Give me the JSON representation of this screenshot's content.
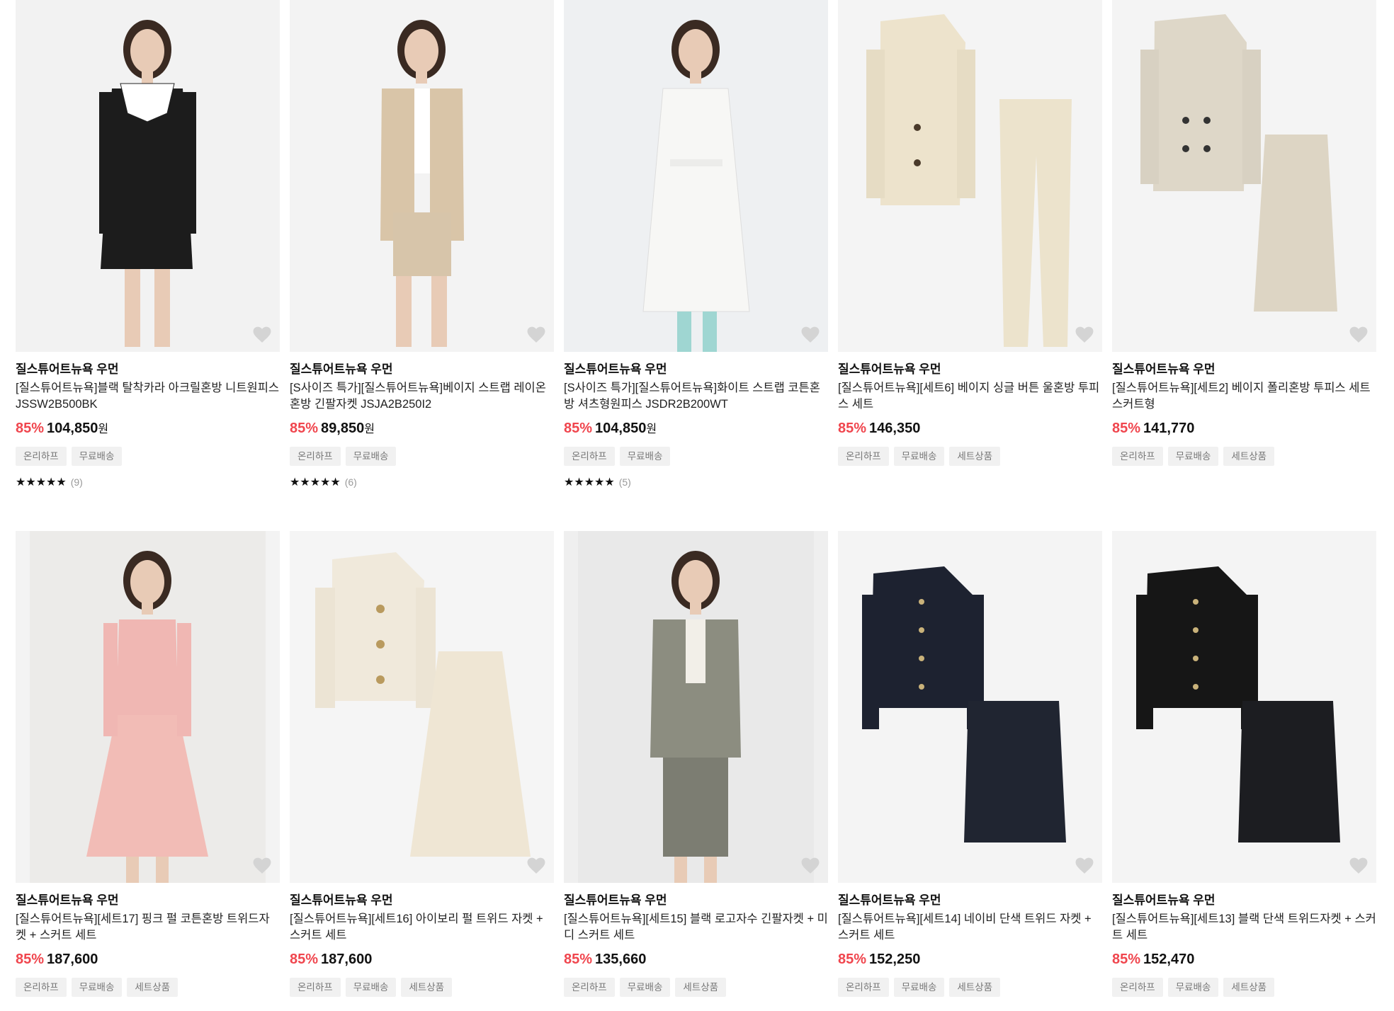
{
  "products": [
    {
      "brand": "질스튜어트뉴욕 우먼",
      "name": "[질스튜어트뉴욕]블랙 탈착카라 아크릴혼방 니트원피스 JSSW2B500BK",
      "discount": "85%",
      "price": "104,850",
      "currency": "원",
      "tags": [
        "온리하프",
        "무료배송"
      ],
      "stars": "★★★★★",
      "review_count": "(9)",
      "image": "model-black-knit-dress"
    },
    {
      "brand": "질스튜어트뉴욕 우먼",
      "name": "[S사이즈 특가][질스튜어트뉴욕]베이지 스트랩 레이온혼방 긴팔자켓 JSJA2B250I2",
      "discount": "85%",
      "price": "89,850",
      "currency": "원",
      "tags": [
        "온리하프",
        "무료배송"
      ],
      "stars": "★★★★★",
      "review_count": "(6)",
      "image": "model-beige-strap-jacket"
    },
    {
      "brand": "질스튜어트뉴욕 우먼",
      "name": "[S사이즈 특가][질스튜어트뉴욕]화이트 스트랩 코튼혼방 셔츠형원피스 JSDR2B200WT",
      "discount": "85%",
      "price": "104,850",
      "currency": "원",
      "tags": [
        "온리하프",
        "무료배송"
      ],
      "stars": "★★★★★",
      "review_count": "(5)",
      "image": "model-white-shirt-dress"
    },
    {
      "brand": "질스튜어트뉴욕 우먼",
      "name": "[질스튜어트뉴욕][세트6] 베이지 싱글 버튼 울혼방 투피스 세트",
      "discount": "85%",
      "price": "146,350",
      "currency": "",
      "tags": [
        "온리하프",
        "무료배송",
        "세트상품"
      ],
      "stars": "",
      "review_count": "",
      "image": "beige-jacket-pants-set"
    },
    {
      "brand": "질스튜어트뉴욕 우먼",
      "name": "[질스튜어트뉴욕][세트2] 베이지 폴리혼방 투피스 세트 스커트형",
      "discount": "85%",
      "price": "141,770",
      "currency": "",
      "tags": [
        "온리하프",
        "무료배송",
        "세트상품"
      ],
      "stars": "",
      "review_count": "",
      "image": "beige-jacket-skirt-set"
    },
    {
      "brand": "질스튜어트뉴욕 우먼",
      "name": "[질스튜어트뉴욕][세트17] 핑크 펄 코튼혼방 트위드자켓 + 스커트 세트",
      "discount": "85%",
      "price": "187,600",
      "currency": "",
      "tags": [
        "온리하프",
        "무료배송",
        "세트상품"
      ],
      "stars": "",
      "review_count": "",
      "image": "model-pink-tweed-set"
    },
    {
      "brand": "질스튜어트뉴욕 우먼",
      "name": "[질스튜어트뉴욕][세트16] 아이보리 펄 트위드 자켓 + 스커트 세트",
      "discount": "85%",
      "price": "187,600",
      "currency": "",
      "tags": [
        "온리하프",
        "무료배송",
        "세트상품"
      ],
      "stars": "",
      "review_count": "",
      "image": "ivory-tweed-set"
    },
    {
      "brand": "질스튜어트뉴욕 우먼",
      "name": "[질스튜어트뉴욕][세트15] 블랙 로고자수 긴팔자켓 + 미디 스커트 세트",
      "discount": "85%",
      "price": "135,660",
      "currency": "",
      "tags": [
        "온리하프",
        "무료배송",
        "세트상품"
      ],
      "stars": "",
      "review_count": "",
      "image": "model-grey-jacket-skirt"
    },
    {
      "brand": "질스튜어트뉴욕 우먼",
      "name": "[질스튜어트뉴욕][세트14] 네이비 단색 트위드 자켓 + 스커트 세트",
      "discount": "85%",
      "price": "152,250",
      "currency": "",
      "tags": [
        "온리하프",
        "무료배송",
        "세트상품"
      ],
      "stars": "",
      "review_count": "",
      "image": "navy-tweed-set"
    },
    {
      "brand": "질스튜어트뉴욕 우먼",
      "name": "[질스튜어트뉴욕][세트13] 블랙 단색 트위드자켓 + 스커트 세트",
      "discount": "85%",
      "price": "152,470",
      "currency": "",
      "tags": [
        "온리하프",
        "무료배송",
        "세트상품"
      ],
      "stars": "",
      "review_count": "",
      "image": "black-tweed-set"
    }
  ],
  "icons": {
    "wishlist": "heart-icon"
  },
  "colors": {
    "discount": "#f0464e",
    "tag_bg": "#f1f1f1",
    "tag_text": "#777777"
  }
}
